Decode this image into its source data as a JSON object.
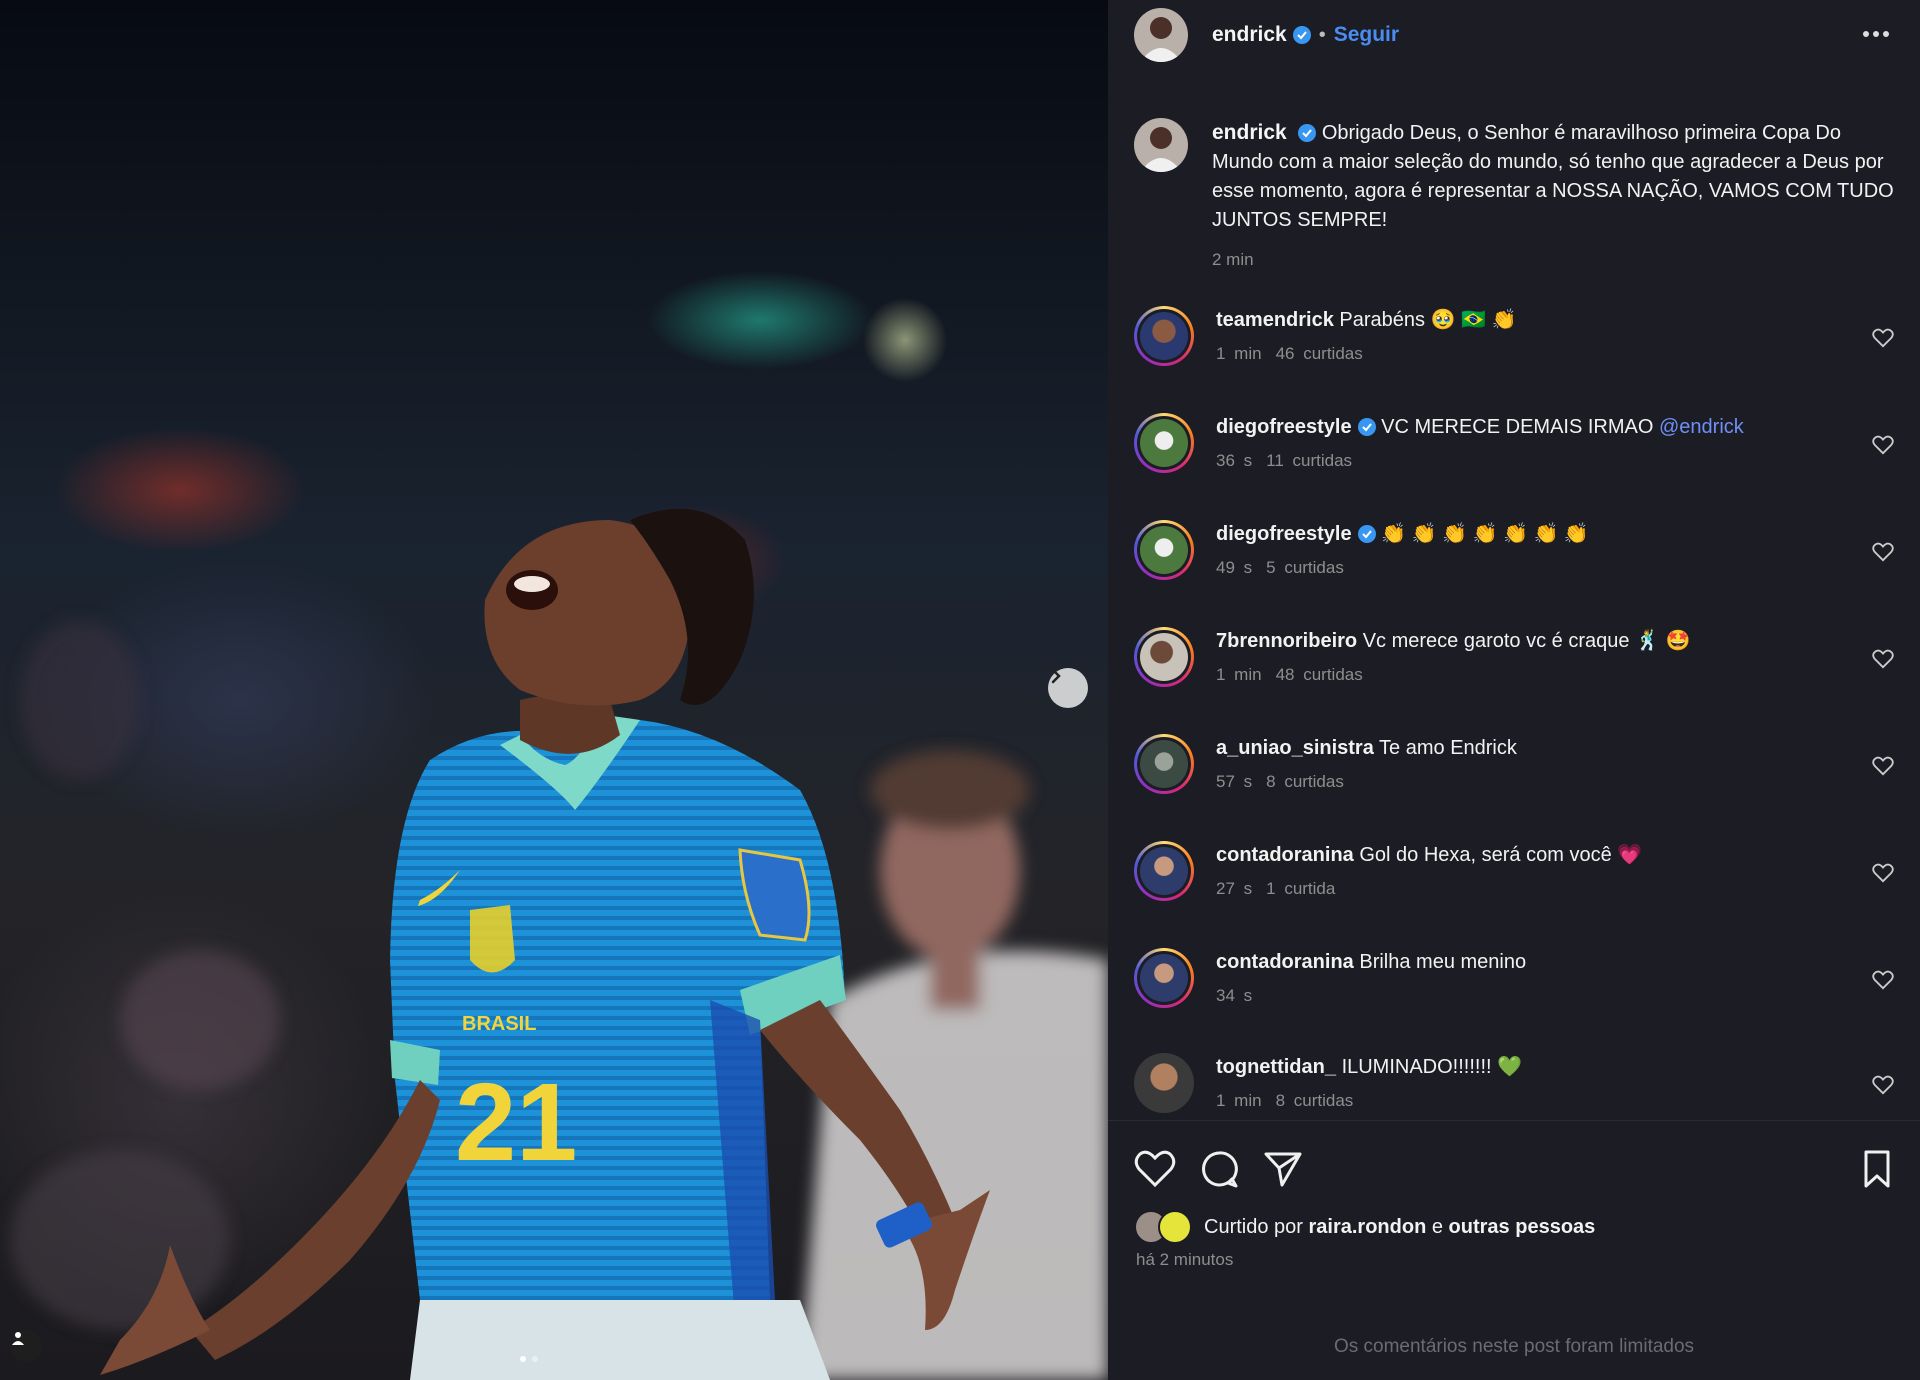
{
  "post": {
    "author": "endrick",
    "follow_label": "Seguir",
    "separator": "•",
    "caption_text": "Obrigado Deus, o Senhor é maravilhoso primeira Copa Do Mundo com a maior seleção do mundo, só tenho que agradecer a Deus por esse momento, agora é representar a NOSSA NAÇÃO, VAMOS COM TUDO JUNTOS SEMPRE!",
    "caption_time": "2 min"
  },
  "comments": [
    {
      "user": "teamendrick",
      "verified": false,
      "text": "Parabéns 🥹 🇧🇷 👏",
      "mention": "",
      "time": "1 min",
      "likes": "46 curtidas"
    },
    {
      "user": "diegofreestyle",
      "verified": true,
      "text": "VC MERECE DEMAIS IRMAO",
      "mention": "@endrick",
      "time": "36 s",
      "likes": "11 curtidas"
    },
    {
      "user": "diegofreestyle",
      "verified": true,
      "text": "👏 👏 👏 👏 👏 👏 👏",
      "mention": "",
      "time": "49 s",
      "likes": "5 curtidas"
    },
    {
      "user": "7brennoribeiro",
      "verified": false,
      "text": "Vc merece garoto vc é craque 🕺 🤩",
      "mention": "",
      "time": "1 min",
      "likes": "48 curtidas"
    },
    {
      "user": "a_uniao_sinistra",
      "verified": false,
      "text": "Te amo Endrick",
      "mention": "",
      "time": "57 s",
      "likes": "8 curtidas"
    },
    {
      "user": "contadoranina",
      "verified": false,
      "text": "Gol do Hexa, será com você 💗",
      "mention": "",
      "time": "27 s",
      "likes": "1 curtida"
    },
    {
      "user": "contadoranina",
      "verified": false,
      "text": "Brilha meu menino",
      "mention": "",
      "time": "34 s",
      "likes": ""
    },
    {
      "user": "tognettidan_",
      "verified": false,
      "text": "ILUMINADO!!!!!!! 💚",
      "mention": "",
      "time": "1 min",
      "likes": "8 curtidas"
    }
  ],
  "likes": {
    "prefix": "Curtido por",
    "user": "raira.rondon",
    "connector": "e",
    "others": "outras pessoas",
    "time_ago": "há 2 minutos"
  },
  "footer": {
    "limited_text": "Os comentários neste post foram limitados"
  },
  "photo": {
    "jersey_number": "21",
    "badge_text": "BRASIL"
  },
  "colors": {
    "panel_bg": "#1c1c24",
    "accent_blue": "#4a8df0",
    "meta_gray": "#8e8e8e",
    "jersey_blue": "#1f8fd6"
  },
  "icons": [
    "next-arrow-icon",
    "tag-user-icon",
    "verified-icon",
    "more-icon",
    "heart-icon",
    "comment-icon",
    "share-icon",
    "bookmark-icon"
  ]
}
